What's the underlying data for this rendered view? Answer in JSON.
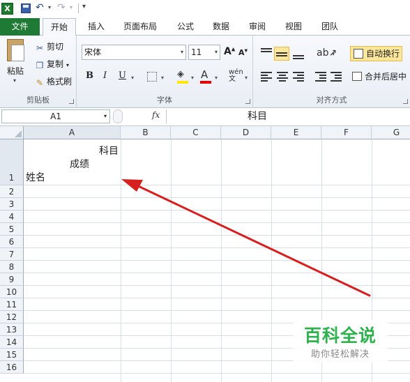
{
  "ribbon_tabs": [
    "文件",
    "开始",
    "插入",
    "页面布局",
    "公式",
    "数据",
    "审阅",
    "视图",
    "团队"
  ],
  "active_tab": "开始",
  "clipboard": {
    "paste_label": "粘贴",
    "cut_label": "剪切",
    "copy_label": "复制",
    "painter_label": "格式刷",
    "group_label": "剪贴板"
  },
  "font": {
    "font_name": "宋体",
    "font_size": "11",
    "bold": "B",
    "italic": "I",
    "underline": "U",
    "group_label": "字体",
    "fill_color": "#ffe600",
    "font_color": "#e00000"
  },
  "alignment": {
    "wrap_label": "自动换行",
    "merge_label": "合并后居中",
    "group_label": "对齐方式"
  },
  "formula_bar": {
    "name_box": "A1",
    "fx": "fx",
    "content": "科目"
  },
  "columns": [
    "A",
    "B",
    "C",
    "D",
    "E",
    "F",
    "G"
  ],
  "rows": [
    "1",
    "2",
    "3",
    "4",
    "5",
    "6",
    "7",
    "8",
    "9",
    "10",
    "11",
    "12",
    "13",
    "14",
    "15",
    "16"
  ],
  "cell_a1": {
    "line1": "科目",
    "line2": "成绩",
    "line3": "姓名"
  },
  "annotation_arrow_color": "#d62020",
  "watermark": {
    "title": "百科全说",
    "subtitle": "助你轻松解决"
  }
}
